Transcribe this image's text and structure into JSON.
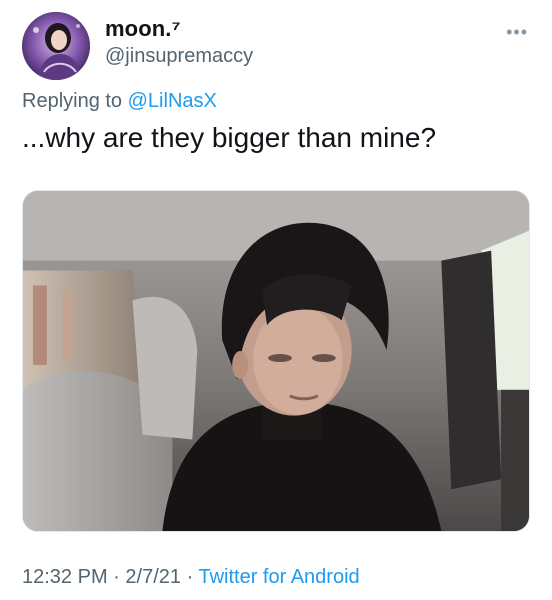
{
  "tweet": {
    "display_name": "moon.⁷",
    "handle": "@jinsupremaccy",
    "more_icon": "more-horizontal-icon",
    "reply_prefix": "Replying to",
    "reply_mention": "@LilNasX",
    "text": "...why are they bigger than mine?",
    "media": {
      "type": "photo"
    },
    "time": "12:32 PM",
    "separator": "·",
    "date": "2/7/21",
    "source": "Twitter for Android"
  },
  "colors": {
    "link": "#1d9bf0",
    "secondary_text": "#536471",
    "primary_text": "#0f1419",
    "background": "#ffffff"
  }
}
